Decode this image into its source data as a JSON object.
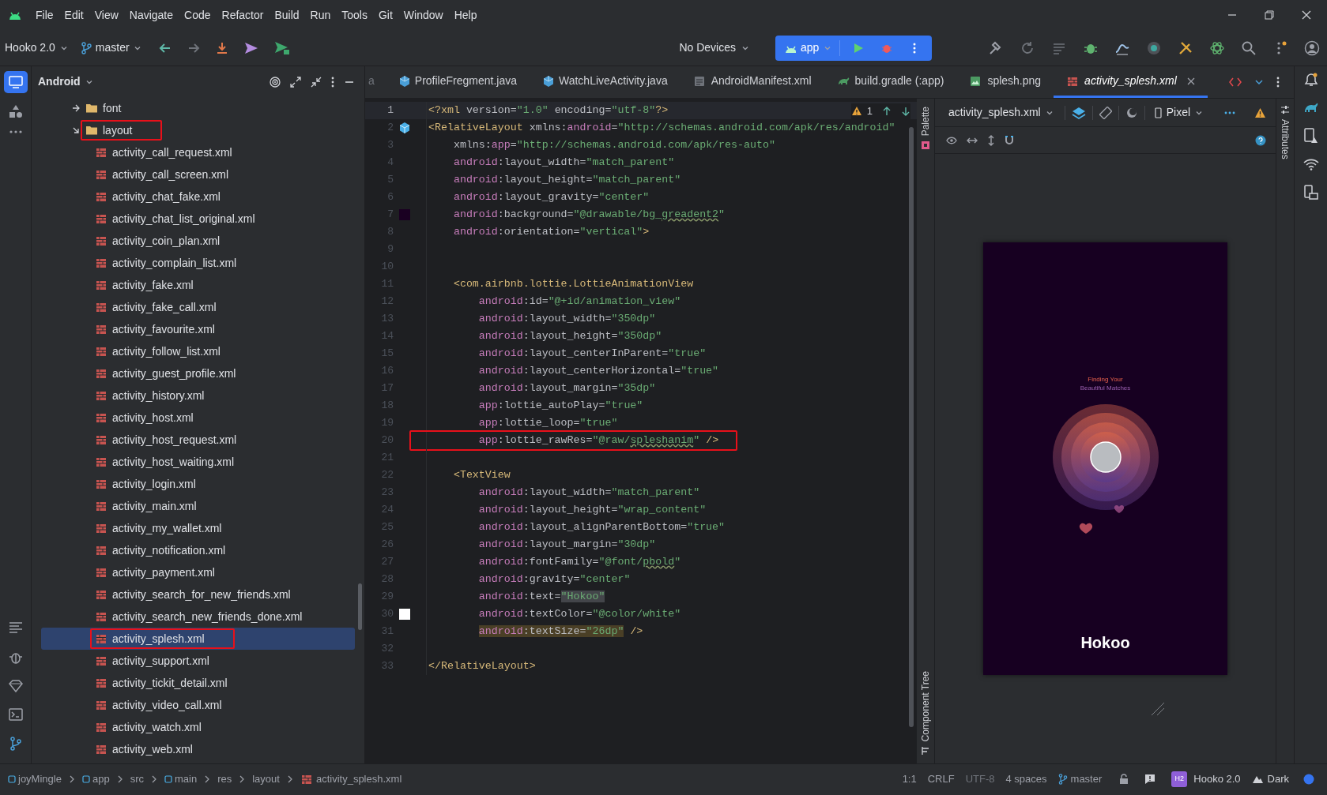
{
  "menu": [
    "File",
    "Edit",
    "View",
    "Navigate",
    "Code",
    "Refactor",
    "Build",
    "Run",
    "Tools",
    "Git",
    "Window",
    "Help"
  ],
  "toolbar": {
    "project": "Hooko 2.0",
    "branch": "master",
    "device": "No Devices",
    "run_config": "app"
  },
  "project_panel": {
    "view": "Android",
    "tree": [
      {
        "label": "font",
        "kind": "folder",
        "expanded": false,
        "selected": false,
        "annotated": false
      },
      {
        "label": "layout",
        "kind": "folder",
        "expanded": true,
        "selected": false,
        "annotated": true,
        "children": [
          {
            "label": "activity_call_request.xml",
            "kind": "layout_file",
            "selected": false,
            "annotated": false
          },
          {
            "label": "activity_call_screen.xml",
            "kind": "layout_file",
            "selected": false,
            "annotated": false
          },
          {
            "label": "activity_chat_fake.xml",
            "kind": "layout_file",
            "selected": false,
            "annotated": false
          },
          {
            "label": "activity_chat_list_original.xml",
            "kind": "layout_file",
            "selected": false,
            "annotated": false
          },
          {
            "label": "activity_coin_plan.xml",
            "kind": "layout_file",
            "selected": false,
            "annotated": false
          },
          {
            "label": "activity_complain_list.xml",
            "kind": "layout_file",
            "selected": false,
            "annotated": false
          },
          {
            "label": "activity_fake.xml",
            "kind": "layout_file",
            "selected": false,
            "annotated": false
          },
          {
            "label": "activity_fake_call.xml",
            "kind": "layout_file",
            "selected": false,
            "annotated": false
          },
          {
            "label": "activity_favourite.xml",
            "kind": "layout_file",
            "selected": false,
            "annotated": false
          },
          {
            "label": "activity_follow_list.xml",
            "kind": "layout_file",
            "selected": false,
            "annotated": false
          },
          {
            "label": "activity_guest_profile.xml",
            "kind": "layout_file",
            "selected": false,
            "annotated": false
          },
          {
            "label": "activity_history.xml",
            "kind": "layout_file",
            "selected": false,
            "annotated": false
          },
          {
            "label": "activity_host.xml",
            "kind": "layout_file",
            "selected": false,
            "annotated": false
          },
          {
            "label": "activity_host_request.xml",
            "kind": "layout_file",
            "selected": false,
            "annotated": false
          },
          {
            "label": "activity_host_waiting.xml",
            "kind": "layout_file",
            "selected": false,
            "annotated": false
          },
          {
            "label": "activity_login.xml",
            "kind": "layout_file",
            "selected": false,
            "annotated": false
          },
          {
            "label": "activity_main.xml",
            "kind": "layout_file",
            "selected": false,
            "annotated": false
          },
          {
            "label": "activity_my_wallet.xml",
            "kind": "layout_file",
            "selected": false,
            "annotated": false
          },
          {
            "label": "activity_notification.xml",
            "kind": "layout_file",
            "selected": false,
            "annotated": false
          },
          {
            "label": "activity_payment.xml",
            "kind": "layout_file",
            "selected": false,
            "annotated": false
          },
          {
            "label": "activity_search_for_new_friends.xml",
            "kind": "layout_file",
            "selected": false,
            "annotated": false
          },
          {
            "label": "activity_search_new_friends_done.xml",
            "kind": "layout_file",
            "selected": false,
            "annotated": false
          },
          {
            "label": "activity_splesh.xml",
            "kind": "layout_file",
            "selected": true,
            "annotated": true
          },
          {
            "label": "activity_support.xml",
            "kind": "layout_file",
            "selected": false,
            "annotated": false
          },
          {
            "label": "activity_tickit_detail.xml",
            "kind": "layout_file",
            "selected": false,
            "annotated": false
          },
          {
            "label": "activity_video_call.xml",
            "kind": "layout_file",
            "selected": false,
            "annotated": false
          },
          {
            "label": "activity_watch.xml",
            "kind": "layout_file",
            "selected": false,
            "annotated": false
          },
          {
            "label": "activity_web.xml",
            "kind": "layout_file",
            "selected": false,
            "annotated": false
          }
        ]
      }
    ]
  },
  "editor_tabs": [
    {
      "label": "a",
      "kind": "none",
      "selected": false,
      "preview": false
    },
    {
      "label": "ProfileFregment.java",
      "kind": "java",
      "selected": false,
      "preview": false
    },
    {
      "label": "WatchLiveActivity.java",
      "kind": "java",
      "selected": false,
      "preview": false
    },
    {
      "label": "AndroidManifest.xml",
      "kind": "manifest",
      "selected": false,
      "preview": false
    },
    {
      "label": "build.gradle (:app)",
      "kind": "gradle",
      "selected": false,
      "preview": false
    },
    {
      "label": "splesh.png",
      "kind": "image",
      "selected": false,
      "preview": false
    },
    {
      "label": "activity_splesh.xml",
      "kind": "layout",
      "selected": true,
      "preview": true
    }
  ],
  "editor": {
    "warnings": "1",
    "lines": [
      {
        "number": "1",
        "current": true,
        "boxed": false,
        "segments": [
          {
            "kind": "tag",
            "text": "<?xml"
          },
          {
            "kind": "attr",
            "text": " version="
          },
          {
            "kind": "str",
            "text": "\"1.0\""
          },
          {
            "kind": "attr",
            "text": " encoding="
          },
          {
            "kind": "str",
            "text": "\"utf-8\""
          },
          {
            "kind": "tag",
            "text": "?>"
          }
        ]
      },
      {
        "number": "2",
        "current": false,
        "boxed": false,
        "gutter": {
          "kind": "component"
        },
        "segments": [
          {
            "kind": "tag",
            "text": "<RelativeLayout"
          },
          {
            "kind": "attr",
            "text": " xmlns:"
          },
          {
            "kind": "ns",
            "text": "android"
          },
          {
            "kind": "attr",
            "text": "="
          },
          {
            "kind": "str",
            "text": "\"http://schemas.android.com/apk/res/android\""
          }
        ]
      },
      {
        "number": "3",
        "current": false,
        "boxed": false,
        "segments": [
          {
            "kind": "attr",
            "text": "    xmlns:"
          },
          {
            "kind": "ns",
            "text": "app"
          },
          {
            "kind": "attr",
            "text": "="
          },
          {
            "kind": "str",
            "text": "\"http://schemas.android.com/apk/res-auto\""
          }
        ]
      },
      {
        "number": "4",
        "current": false,
        "boxed": false,
        "segments": [
          {
            "kind": "ns",
            "text": "    android"
          },
          {
            "kind": "attr",
            "text": ":layout_width="
          },
          {
            "kind": "str",
            "text": "\"match_parent\""
          }
        ]
      },
      {
        "number": "5",
        "current": false,
        "boxed": false,
        "segments": [
          {
            "kind": "ns",
            "text": "    android"
          },
          {
            "kind": "attr",
            "text": ":layout_height="
          },
          {
            "kind": "str",
            "text": "\"match_parent\""
          }
        ]
      },
      {
        "number": "6",
        "current": false,
        "boxed": false,
        "segments": [
          {
            "kind": "ns",
            "text": "    android"
          },
          {
            "kind": "attr",
            "text": ":layout_gravity="
          },
          {
            "kind": "str",
            "text": "\"center\""
          }
        ]
      },
      {
        "number": "7",
        "current": false,
        "boxed": false,
        "gutter": {
          "kind": "color",
          "color": "#1a0022"
        },
        "segments": [
          {
            "kind": "ns",
            "text": "    android"
          },
          {
            "kind": "attr",
            "text": ":background="
          },
          {
            "kind": "str",
            "text": "\"@drawable/bg_"
          },
          {
            "kind": "str",
            "text": "greadent2",
            "typo": true
          },
          {
            "kind": "str",
            "text": "\""
          }
        ]
      },
      {
        "number": "8",
        "current": false,
        "boxed": false,
        "segments": [
          {
            "kind": "ns",
            "text": "    android"
          },
          {
            "kind": "attr",
            "text": ":orientation="
          },
          {
            "kind": "str",
            "text": "\"vertical\""
          },
          {
            "kind": "tag",
            "text": ">"
          }
        ]
      },
      {
        "number": "9",
        "current": false
      },
      {
        "number": "10",
        "current": false
      },
      {
        "number": "11",
        "current": false,
        "boxed": false,
        "segments": [
          {
            "kind": "tag",
            "text": "    <com.airbnb.lottie.LottieAnimationView"
          }
        ]
      },
      {
        "number": "12",
        "current": false,
        "boxed": false,
        "segments": [
          {
            "kind": "ns",
            "text": "        android"
          },
          {
            "kind": "attr",
            "text": ":id="
          },
          {
            "kind": "str",
            "text": "\"@+id/animation_view\""
          }
        ]
      },
      {
        "number": "13",
        "current": false,
        "boxed": false,
        "segments": [
          {
            "kind": "ns",
            "text": "        android"
          },
          {
            "kind": "attr",
            "text": ":layout_width="
          },
          {
            "kind": "str",
            "text": "\"350dp\""
          }
        ]
      },
      {
        "number": "14",
        "current": false,
        "boxed": false,
        "segments": [
          {
            "kind": "ns",
            "text": "        android"
          },
          {
            "kind": "attr",
            "text": ":layout_height="
          },
          {
            "kind": "str",
            "text": "\"350dp\""
          }
        ]
      },
      {
        "number": "15",
        "current": false,
        "boxed": false,
        "segments": [
          {
            "kind": "ns",
            "text": "        android"
          },
          {
            "kind": "attr",
            "text": ":layout_centerInParent="
          },
          {
            "kind": "str",
            "text": "\"true\""
          }
        ]
      },
      {
        "number": "16",
        "current": false,
        "boxed": false,
        "segments": [
          {
            "kind": "ns",
            "text": "        android"
          },
          {
            "kind": "attr",
            "text": ":layout_centerHorizontal="
          },
          {
            "kind": "str",
            "text": "\"true\""
          }
        ]
      },
      {
        "number": "17",
        "current": false,
        "boxed": false,
        "segments": [
          {
            "kind": "ns",
            "text": "        android"
          },
          {
            "kind": "attr",
            "text": ":layout_margin="
          },
          {
            "kind": "str",
            "text": "\"35dp\""
          }
        ]
      },
      {
        "number": "18",
        "current": false,
        "boxed": false,
        "segments": [
          {
            "kind": "ns",
            "text": "        app"
          },
          {
            "kind": "attr",
            "text": ":lottie_autoPlay="
          },
          {
            "kind": "str",
            "text": "\"true\""
          }
        ]
      },
      {
        "number": "19",
        "current": false,
        "boxed": false,
        "segments": [
          {
            "kind": "ns",
            "text": "        app"
          },
          {
            "kind": "attr",
            "text": ":lottie_loop="
          },
          {
            "kind": "str",
            "text": "\"true\""
          }
        ]
      },
      {
        "number": "20",
        "current": false,
        "boxed": true,
        "segments": [
          {
            "kind": "ns",
            "text": "        app"
          },
          {
            "kind": "attr",
            "text": ":lottie_rawRes="
          },
          {
            "kind": "str",
            "text": "\"@raw/"
          },
          {
            "kind": "str",
            "text": "spleshanim",
            "typo": true
          },
          {
            "kind": "str",
            "text": "\""
          },
          {
            "kind": "tag",
            "text": " />"
          }
        ]
      },
      {
        "number": "21",
        "current": false
      },
      {
        "number": "22",
        "current": false,
        "boxed": false,
        "segments": [
          {
            "kind": "tag",
            "text": "    <TextView"
          }
        ]
      },
      {
        "number": "23",
        "current": false,
        "boxed": false,
        "segments": [
          {
            "kind": "ns",
            "text": "        android"
          },
          {
            "kind": "attr",
            "text": ":layout_width="
          },
          {
            "kind": "str",
            "text": "\"match_parent\""
          }
        ]
      },
      {
        "number": "24",
        "current": false,
        "boxed": false,
        "segments": [
          {
            "kind": "ns",
            "text": "        android"
          },
          {
            "kind": "attr",
            "text": ":layout_height="
          },
          {
            "kind": "str",
            "text": "\"wrap_content\""
          }
        ]
      },
      {
        "number": "25",
        "current": false,
        "boxed": false,
        "segments": [
          {
            "kind": "ns",
            "text": "        android"
          },
          {
            "kind": "attr",
            "text": ":layout_alignParentBottom="
          },
          {
            "kind": "str",
            "text": "\"true\""
          }
        ]
      },
      {
        "number": "26",
        "current": false,
        "boxed": false,
        "segments": [
          {
            "kind": "ns",
            "text": "        android"
          },
          {
            "kind": "attr",
            "text": ":layout_margin="
          },
          {
            "kind": "str",
            "text": "\"30dp\""
          }
        ]
      },
      {
        "number": "27",
        "current": false,
        "boxed": false,
        "segments": [
          {
            "kind": "ns",
            "text": "        android"
          },
          {
            "kind": "attr",
            "text": ":fontFamily="
          },
          {
            "kind": "str",
            "text": "\"@font/"
          },
          {
            "kind": "str",
            "text": "pbold",
            "typo": true
          },
          {
            "kind": "str",
            "text": "\""
          }
        ]
      },
      {
        "number": "28",
        "current": false,
        "boxed": false,
        "segments": [
          {
            "kind": "ns",
            "text": "        android"
          },
          {
            "kind": "attr",
            "text": ":gravity="
          },
          {
            "kind": "str",
            "text": "\"center\""
          }
        ]
      },
      {
        "number": "29",
        "current": false,
        "boxed": false,
        "segments": [
          {
            "kind": "ns",
            "text": "        android"
          },
          {
            "kind": "attr",
            "text": ":text="
          },
          {
            "kind": "str",
            "text": "\"Hokoo\"",
            "selected": true
          }
        ]
      },
      {
        "number": "30",
        "current": false,
        "boxed": false,
        "gutter": {
          "kind": "color",
          "color": "#ffffff"
        },
        "segments": [
          {
            "kind": "ns",
            "text": "        android"
          },
          {
            "kind": "attr",
            "text": ":textColor="
          },
          {
            "kind": "str",
            "text": "\"@color/white\""
          }
        ]
      },
      {
        "number": "31",
        "current": false,
        "boxed": false,
        "segments": [
          {
            "kind": "ns",
            "text": "        android",
            "flagged": true
          },
          {
            "kind": "attr",
            "text": ":textSize=",
            "flagged": true
          },
          {
            "kind": "str",
            "text": "\"26dp\"",
            "flagged": true
          },
          {
            "kind": "tag",
            "text": " />"
          }
        ]
      },
      {
        "number": "32",
        "current": false
      },
      {
        "number": "33",
        "current": false,
        "boxed": false,
        "segments": [
          {
            "kind": "tag",
            "text": "</RelativeLayout>"
          }
        ]
      }
    ]
  },
  "side_labels": {
    "palette": "Palette",
    "component_tree": "Component Tree",
    "attributes": "Attributes"
  },
  "preview": {
    "file": "activity_splesh.xml",
    "device": "Pixel",
    "screen": {
      "tagline_top": "Finding Your",
      "tagline_bottom": "Beautiful Matches",
      "title": "Hokoo"
    }
  },
  "breadcrumbs": [
    {
      "label": "joyMingle",
      "kind": "module"
    },
    {
      "label": "app",
      "kind": "module"
    },
    {
      "label": "src",
      "kind": "folder"
    },
    {
      "label": "main",
      "kind": "module"
    },
    {
      "label": "res",
      "kind": "folder"
    },
    {
      "label": "layout",
      "kind": "folder"
    },
    {
      "label": "activity_splesh.xml",
      "kind": "file"
    }
  ],
  "status": {
    "position": "1:1",
    "line_separator": "CRLF",
    "encoding": "UTF-8",
    "indent": "4 spaces",
    "branch": "master",
    "project_badge": "H2",
    "project": "Hooko 2.0",
    "theme": "Dark"
  }
}
